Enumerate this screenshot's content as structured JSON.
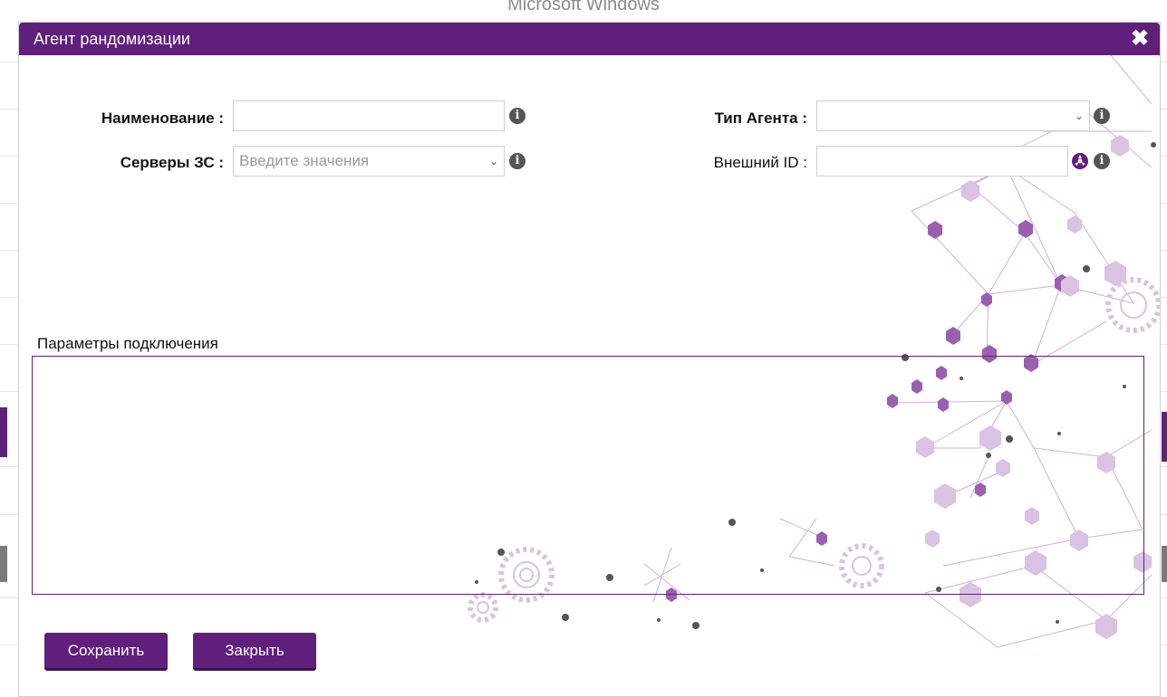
{
  "background": {
    "window_title": "Microsoft Windows"
  },
  "dialog": {
    "title": "Агент рандомизации",
    "close_icon": "close-icon",
    "fields": {
      "name_label": "Наименование :",
      "name_value": "",
      "servers_label": "Серверы ЗС :",
      "servers_placeholder": "Введите значения",
      "agent_type_label": "Тип Агента :",
      "agent_type_value": "",
      "external_id_label": "Внешний ID :",
      "external_id_value": ""
    },
    "params_label": "Параметры подключения",
    "buttons": {
      "save": "Сохранить",
      "close": "Закрыть"
    },
    "colors": {
      "accent": "#5f1f7a",
      "decor": "#9b5fb0"
    }
  }
}
